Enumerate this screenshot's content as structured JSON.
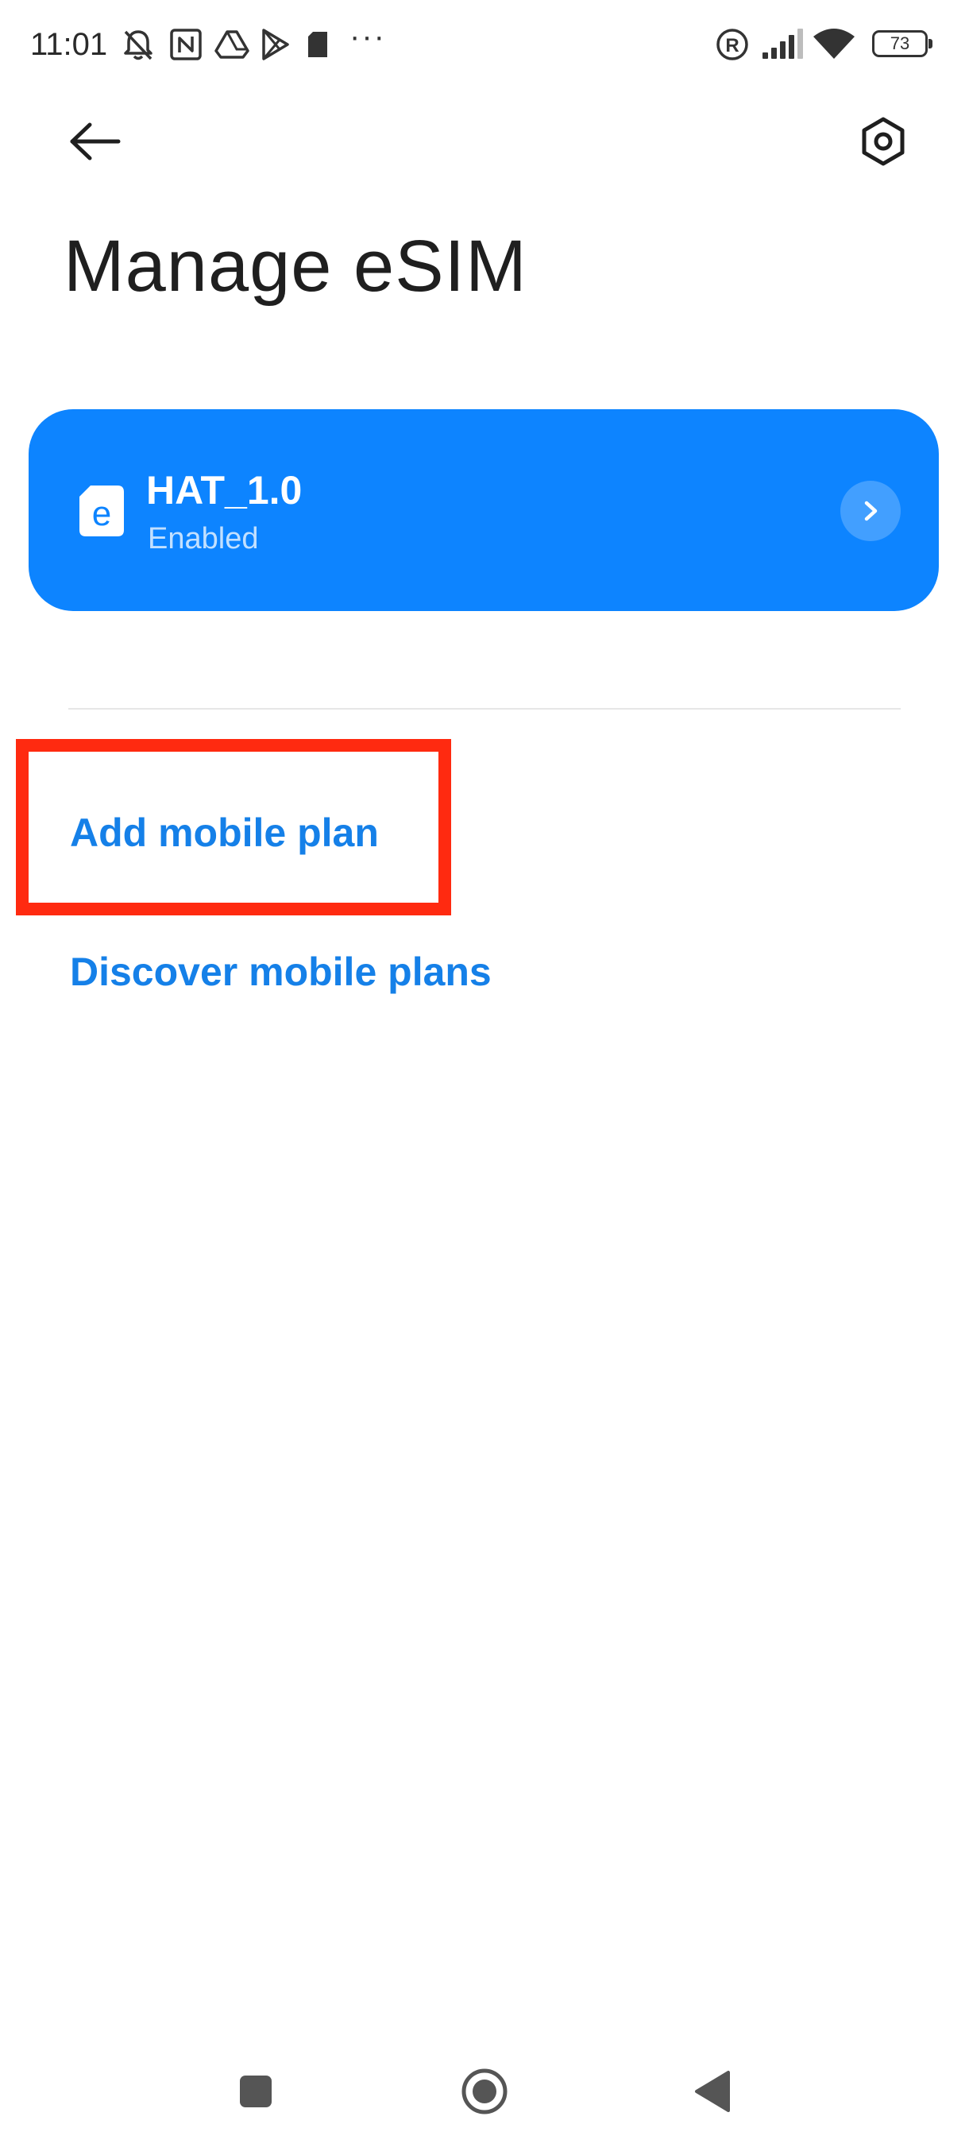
{
  "status_bar": {
    "time": "11:01",
    "battery_level": "73",
    "more_indicator": "···",
    "icons": [
      "bell-off-icon",
      "nfc-icon",
      "drive-icon",
      "play-store-icon",
      "sim-card-icon",
      "roaming-icon",
      "signal-icon",
      "wifi-icon",
      "battery-icon"
    ]
  },
  "header": {
    "title": "Manage eSIM",
    "back_icon": "arrow-left-icon",
    "settings_icon": "hexagon-gear-icon"
  },
  "esim_card": {
    "name": "HAT_1.0",
    "status": "Enabled",
    "icon": "esim-icon",
    "accent_color": "#0d84ff"
  },
  "actions": {
    "add_plan_label": "Add mobile plan",
    "discover_plans_label": "Discover mobile plans",
    "link_color": "#1580e8",
    "highlight_color": "#ff2a10"
  },
  "nav_bar": {
    "icons": [
      "recents-square-icon",
      "home-circle-icon",
      "back-triangle-icon"
    ]
  }
}
